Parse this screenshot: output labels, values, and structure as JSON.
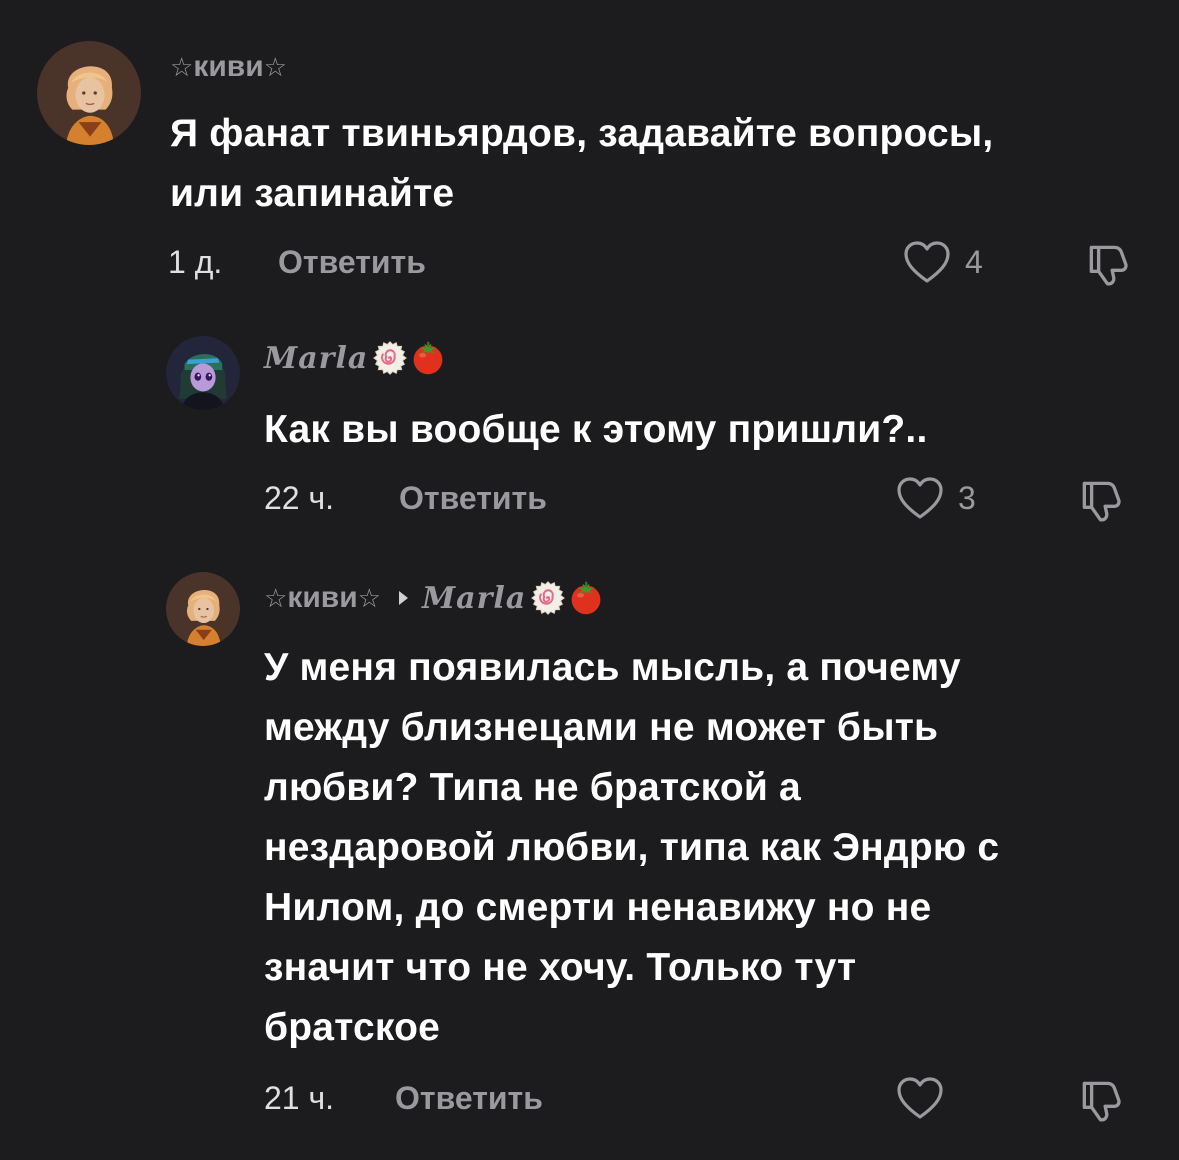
{
  "comments": [
    {
      "username": "киви",
      "text_lines": [
        "Я фанат твиньярдов, задавайте вопросы,",
        "или запинайте"
      ],
      "time": "1 д.",
      "reply_label": "Ответить",
      "likes": "4",
      "avatar_icon": "avatar-blonde-portrait",
      "like_icon": "heart-outline-icon",
      "dislike_icon": "thumbs-down-icon"
    },
    {
      "username": "Marla",
      "text_lines": [
        "Как вы вообще к этому пришли?.."
      ],
      "time": "22 ч.",
      "reply_label": "Ответить",
      "likes": "3",
      "avatar_icon": "avatar-anime-purple",
      "emojis": [
        "fishcake-emoji",
        "tomato-emoji"
      ],
      "like_icon": "heart-outline-icon",
      "dislike_icon": "thumbs-down-icon"
    },
    {
      "username": "киви",
      "reply_to": "Marla",
      "text_lines": [
        "У меня появилась мысль, а почему",
        "между близнецами не может быть",
        "любви? Типа не братской а",
        "нездаровой любви, типа как Эндрю с",
        "Нилом, до смерти ненавижу но не",
        "значит что не хочу. Только тут",
        "братское"
      ],
      "time": "21 ч.",
      "reply_label": "Ответить",
      "likes": "",
      "avatar_icon": "avatar-blonde-portrait",
      "emojis": [
        "fishcake-emoji",
        "tomato-emoji"
      ],
      "like_icon": "heart-outline-icon",
      "dislike_icon": "thumbs-down-icon"
    }
  ],
  "colors": {
    "background": "#1c1c1e",
    "text": "#ffffff",
    "muted": "#9a9a9e"
  }
}
